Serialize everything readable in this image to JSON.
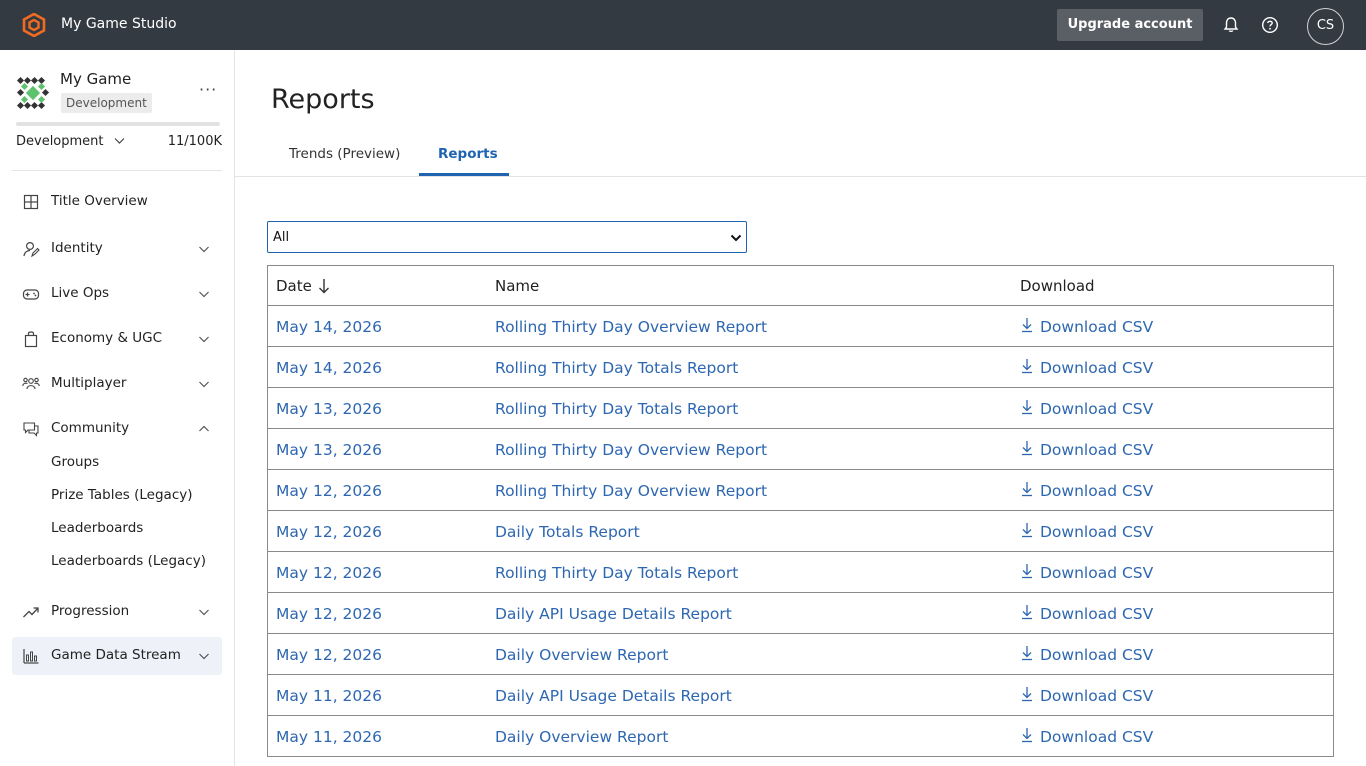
{
  "topbar": {
    "studio_name": "My Game Studio",
    "upgrade_label": "Upgrade account",
    "avatar_initials": "CS"
  },
  "sidebar": {
    "game_name": "My Game",
    "env_badge": "Development",
    "env_select": "Development",
    "usage": "11/100K",
    "usage_fraction": 0.00011,
    "items": [
      {
        "label": "Title Overview",
        "icon": "grid-icon"
      },
      {
        "label": "Identity",
        "icon": "identity-icon"
      },
      {
        "label": "Live Ops",
        "icon": "gamepad-icon"
      },
      {
        "label": "Economy & UGC",
        "icon": "shopping-bag-icon"
      },
      {
        "label": "Multiplayer",
        "icon": "people-icon"
      },
      {
        "label": "Community",
        "icon": "chat-icon"
      },
      {
        "label": "Progression",
        "icon": "trending-up-icon"
      },
      {
        "label": "Game Data Stream",
        "icon": "bar-chart-icon"
      }
    ],
    "community_sub": [
      "Groups",
      "Prize Tables (Legacy)",
      "Leaderboards",
      "Leaderboards (Legacy)"
    ]
  },
  "main": {
    "title": "Reports",
    "tabs": [
      "Trends (Preview)",
      "Reports"
    ],
    "active_tab": "Reports",
    "filter_value": "All",
    "table": {
      "headers": {
        "date": "Date",
        "name": "Name",
        "download": "Download"
      },
      "rows": [
        {
          "date": "May 14, 2026",
          "name": "Rolling Thirty Day Overview Report",
          "download": "Download CSV"
        },
        {
          "date": "May 14, 2026",
          "name": "Rolling Thirty Day Totals Report",
          "download": "Download CSV"
        },
        {
          "date": "May 13, 2026",
          "name": "Rolling Thirty Day Totals Report",
          "download": "Download CSV"
        },
        {
          "date": "May 13, 2026",
          "name": "Rolling Thirty Day Overview Report",
          "download": "Download CSV"
        },
        {
          "date": "May 12, 2026",
          "name": "Rolling Thirty Day Overview Report",
          "download": "Download CSV"
        },
        {
          "date": "May 12, 2026",
          "name": "Daily Totals Report",
          "download": "Download CSV"
        },
        {
          "date": "May 12, 2026",
          "name": "Rolling Thirty Day Totals Report",
          "download": "Download CSV"
        },
        {
          "date": "May 12, 2026",
          "name": "Daily API Usage Details Report",
          "download": "Download CSV"
        },
        {
          "date": "May 12, 2026",
          "name": "Daily Overview Report",
          "download": "Download CSV"
        },
        {
          "date": "May 11, 2026",
          "name": "Daily API Usage Details Report",
          "download": "Download CSV"
        },
        {
          "date": "May 11, 2026",
          "name": "Daily Overview Report",
          "download": "Download CSV"
        }
      ]
    }
  },
  "colors": {
    "topbar": "#343a42",
    "link": "#2e67b1",
    "accent": "#1f64b0",
    "brand": "#f26b21"
  }
}
